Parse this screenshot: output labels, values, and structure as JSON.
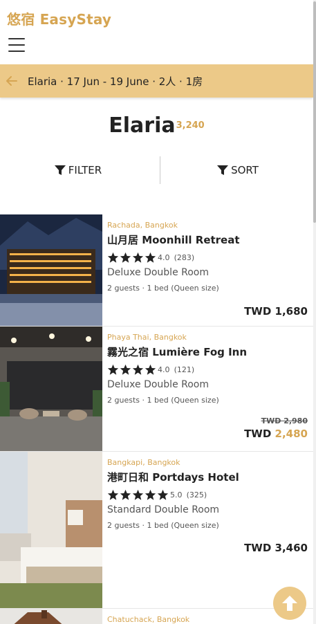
{
  "header": {
    "brand": "悠宿 EasyStay"
  },
  "search": {
    "summary": "Elaria · 17 Jun - 19 June · 2人 · 1房"
  },
  "results": {
    "title": "Elaria",
    "count": "3,240"
  },
  "controls": {
    "filter_label": "FILTER",
    "sort_label": "SORT"
  },
  "colors": {
    "accent": "#d6a552",
    "bar": "#ecc988"
  },
  "hotels": [
    {
      "location": "Rachada, Bangkok",
      "name": "山月居 Moonhill Retreat",
      "stars": 4,
      "rating": "4.0",
      "reviews": "(283)",
      "room": "Deluxe Double Room",
      "guests": "2 guests · 1 bed (Queen size)",
      "price_label": "TWD",
      "price": "1,680"
    },
    {
      "location": "Phaya Thai, Bangkok",
      "name": "霧光之宿 Lumière Fog Inn",
      "stars": 4,
      "rating": "4.0",
      "reviews": "(121)",
      "room": "Deluxe Double Room",
      "guests": "2 guests · 1 bed (Queen size)",
      "old_price": "TWD 2,980",
      "price_label": "TWD",
      "price": "2,480"
    },
    {
      "location": "Bangkapi, Bangkok",
      "name": "港町日和 Portdays Hotel",
      "stars": 5,
      "rating": "5.0",
      "reviews": "(325)",
      "room": "Standard Double Room",
      "guests": "2 guests · 1 bed (Queen size)",
      "price_label": "TWD",
      "price": "3,460"
    },
    {
      "location": "Chatuchack, Bangkok"
    }
  ]
}
